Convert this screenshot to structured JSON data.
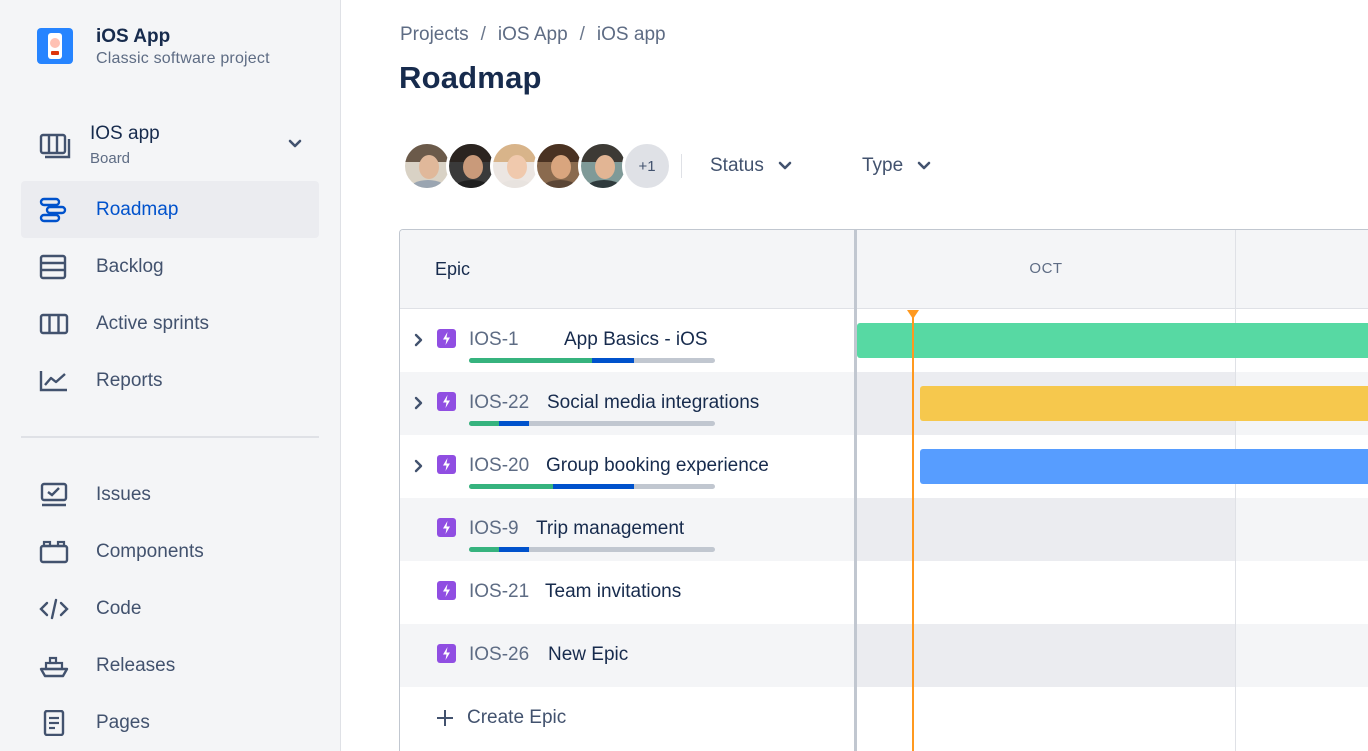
{
  "project": {
    "name": "iOS App",
    "subtitle": "Classic software project"
  },
  "board": {
    "name": "IOS app",
    "type": "Board"
  },
  "nav": {
    "roadmap": "Roadmap",
    "backlog": "Backlog",
    "active_sprints": "Active sprints",
    "reports": "Reports",
    "issues": "Issues",
    "components": "Components",
    "code": "Code",
    "releases": "Releases",
    "pages": "Pages"
  },
  "breadcrumb": [
    "Projects",
    "iOS App",
    "iOS app"
  ],
  "page_title": "Roadmap",
  "avatars_more": "+1",
  "filters": {
    "status": "Status",
    "type": "Type"
  },
  "table": {
    "epic_header": "Epic",
    "month": "OCT",
    "create_epic": "Create Epic"
  },
  "epics": [
    {
      "key": "IOS-1",
      "name": "App Basics - iOS",
      "done": 0.5,
      "in_progress": 0.17,
      "bar_color": "#57d9a3"
    },
    {
      "key": "IOS-22",
      "name": "Social media integrations",
      "done": 0.12,
      "in_progress": 0.12,
      "bar_color": "#f6c84d"
    },
    {
      "key": "IOS-20",
      "name": "Group booking experience",
      "done": 0.34,
      "in_progress": 0.33,
      "bar_color": "#579dff"
    },
    {
      "key": "IOS-9",
      "name": "Trip management",
      "done": 0.12,
      "in_progress": 0.12,
      "bar_color": null
    },
    {
      "key": "IOS-21",
      "name": "Team invitations",
      "done": null,
      "in_progress": null,
      "bar_color": null
    },
    {
      "key": "IOS-26",
      "name": "New Epic",
      "done": null,
      "in_progress": null,
      "bar_color": null
    }
  ],
  "colors": {
    "accent": "#0052cc",
    "epic_icon": "#904ee2",
    "today_marker": "#ff991f"
  }
}
